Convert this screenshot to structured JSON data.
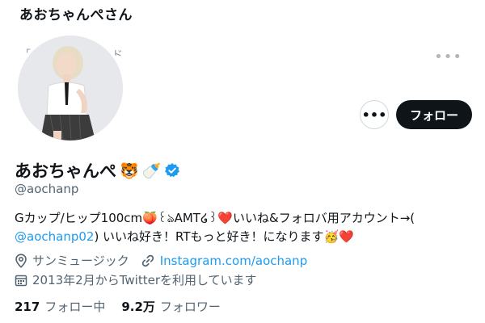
{
  "header": {
    "title": "あおちゃんぺさん"
  },
  "banner": {
    "fragment_left": "「",
    "fragment_right": "ド"
  },
  "actions": {
    "more_icon": "more-horizontal-icon",
    "more_button": "•••",
    "follow_label": "フォロー"
  },
  "profile": {
    "display_name": "あおちゃんぺ",
    "name_emojis": [
      "🐯",
      "🍼"
    ],
    "verified_icon": "verified-badge-icon",
    "handle": "@aochanp",
    "bio": {
      "part1": "Gカップ/ヒップ100cm",
      "emoji1": "🍑",
      "part2": "꒰ঌAMT໒꒱",
      "emoji2": "❤️",
      "part3": "いいね&フォロバ用アカウント→(",
      "mention": "@aochanp02",
      "part4": ") いいね好き！RTもっと好き！になります",
      "emoji3": "🥳",
      "emoji4": "❤️"
    },
    "location": "サンミュージック",
    "location_icon": "location-pin-icon",
    "website": "Instagram.com/aochanp",
    "website_icon": "link-icon",
    "joined": "2013年2月からTwitterを利用しています",
    "joined_icon": "calendar-icon"
  },
  "stats": {
    "following_count": "217",
    "following_label": "フォロー中",
    "followers_count": "9.2万",
    "followers_label": "フォロワー"
  },
  "colors": {
    "accent": "#1d9bf0",
    "text": "#0f1419",
    "secondary": "#536471",
    "button_dark": "#0f1419"
  }
}
